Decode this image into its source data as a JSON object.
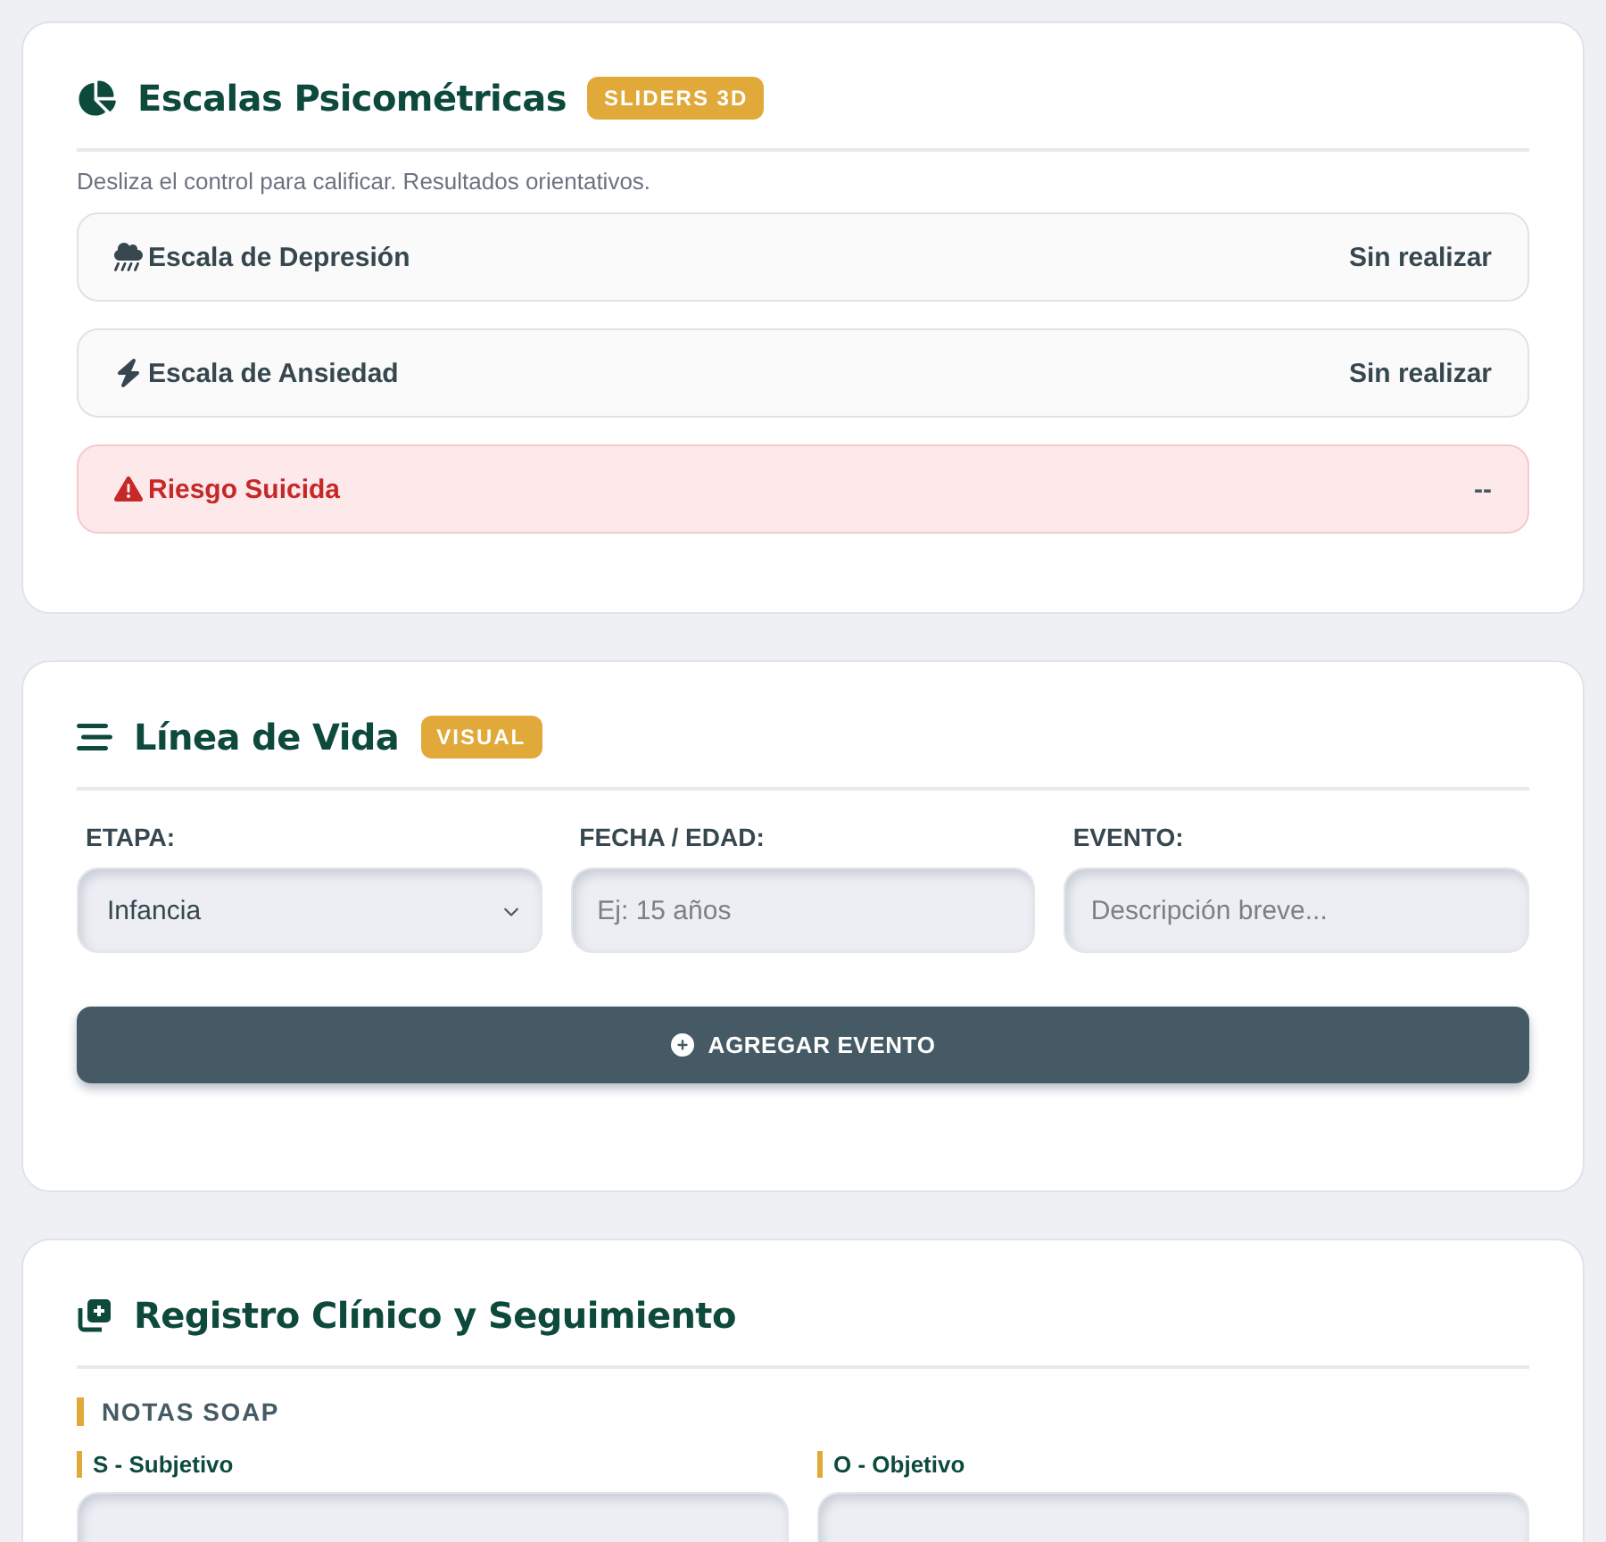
{
  "scales_card": {
    "title": "Escalas Psicométricas",
    "badge": "SLIDERS 3D",
    "hint": "Desliza el control para calificar. Resultados orientativos.",
    "scales": [
      {
        "kind": "scale",
        "label": "Escala de Depresión",
        "status": "Sin realizar"
      },
      {
        "kind": "scale",
        "label": "Escala de Ansiedad",
        "status": "Sin realizar"
      },
      {
        "kind": "alert",
        "label": "Riesgo Suicida",
        "status": "--"
      }
    ]
  },
  "lifeline_card": {
    "title": "Línea de Vida",
    "badge": "VISUAL",
    "fields": [
      {
        "kind": "select",
        "label": "ETAPA:",
        "value": "Infancia"
      },
      {
        "kind": "input",
        "label": "FECHA / EDAD:",
        "placeholder": "Ej: 15 años"
      },
      {
        "kind": "input",
        "label": "EVENTO:",
        "placeholder": "Descripción breve..."
      }
    ],
    "button": "AGREGAR EVENTO"
  },
  "record_card": {
    "title": "Registro Clínico y Seguimiento",
    "section": "NOTAS SOAP",
    "notes": [
      {
        "label": "S - Subjetivo"
      },
      {
        "label": "O - Objetivo"
      }
    ]
  }
}
